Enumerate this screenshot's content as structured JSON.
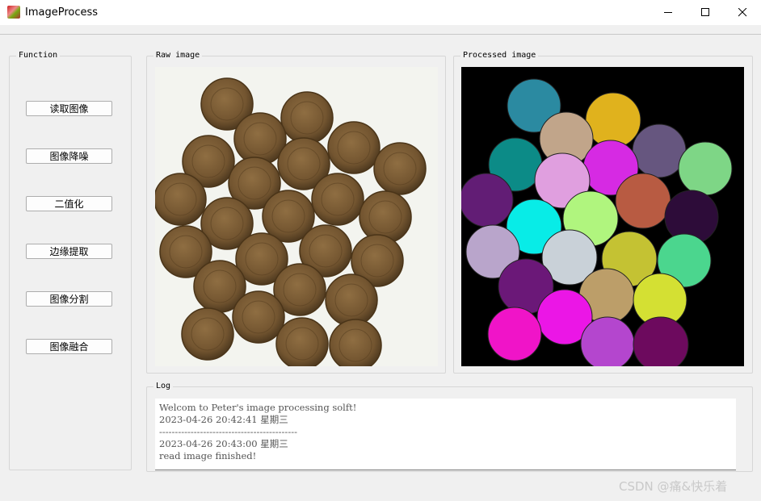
{
  "window": {
    "title": "ImageProcess",
    "controls": {
      "minimize": "minimize-icon",
      "maximize": "maximize-icon",
      "close": "close-icon"
    }
  },
  "function_panel": {
    "title": "Function",
    "buttons": [
      "读取图像",
      "图像降噪",
      "二值化",
      "边缘提取",
      "图像分割",
      "图像融合"
    ]
  },
  "raw_panel": {
    "title": "Raw image"
  },
  "processed_panel": {
    "title": "Processed image"
  },
  "log_panel": {
    "title": "Log",
    "lines": [
      "Welcom to Peter's image processing solft!",
      "2023-04-26 20:42:41 星期三",
      "--------------------------------------------",
      "2023-04-26 20:43:00 星期三",
      "read image finished!"
    ]
  },
  "watermark": "CSDN @痛&快乐着",
  "colors": {
    "window_bg": "#f0f0f0",
    "coin": "#7a5c34",
    "processed_bg": "#000000"
  }
}
